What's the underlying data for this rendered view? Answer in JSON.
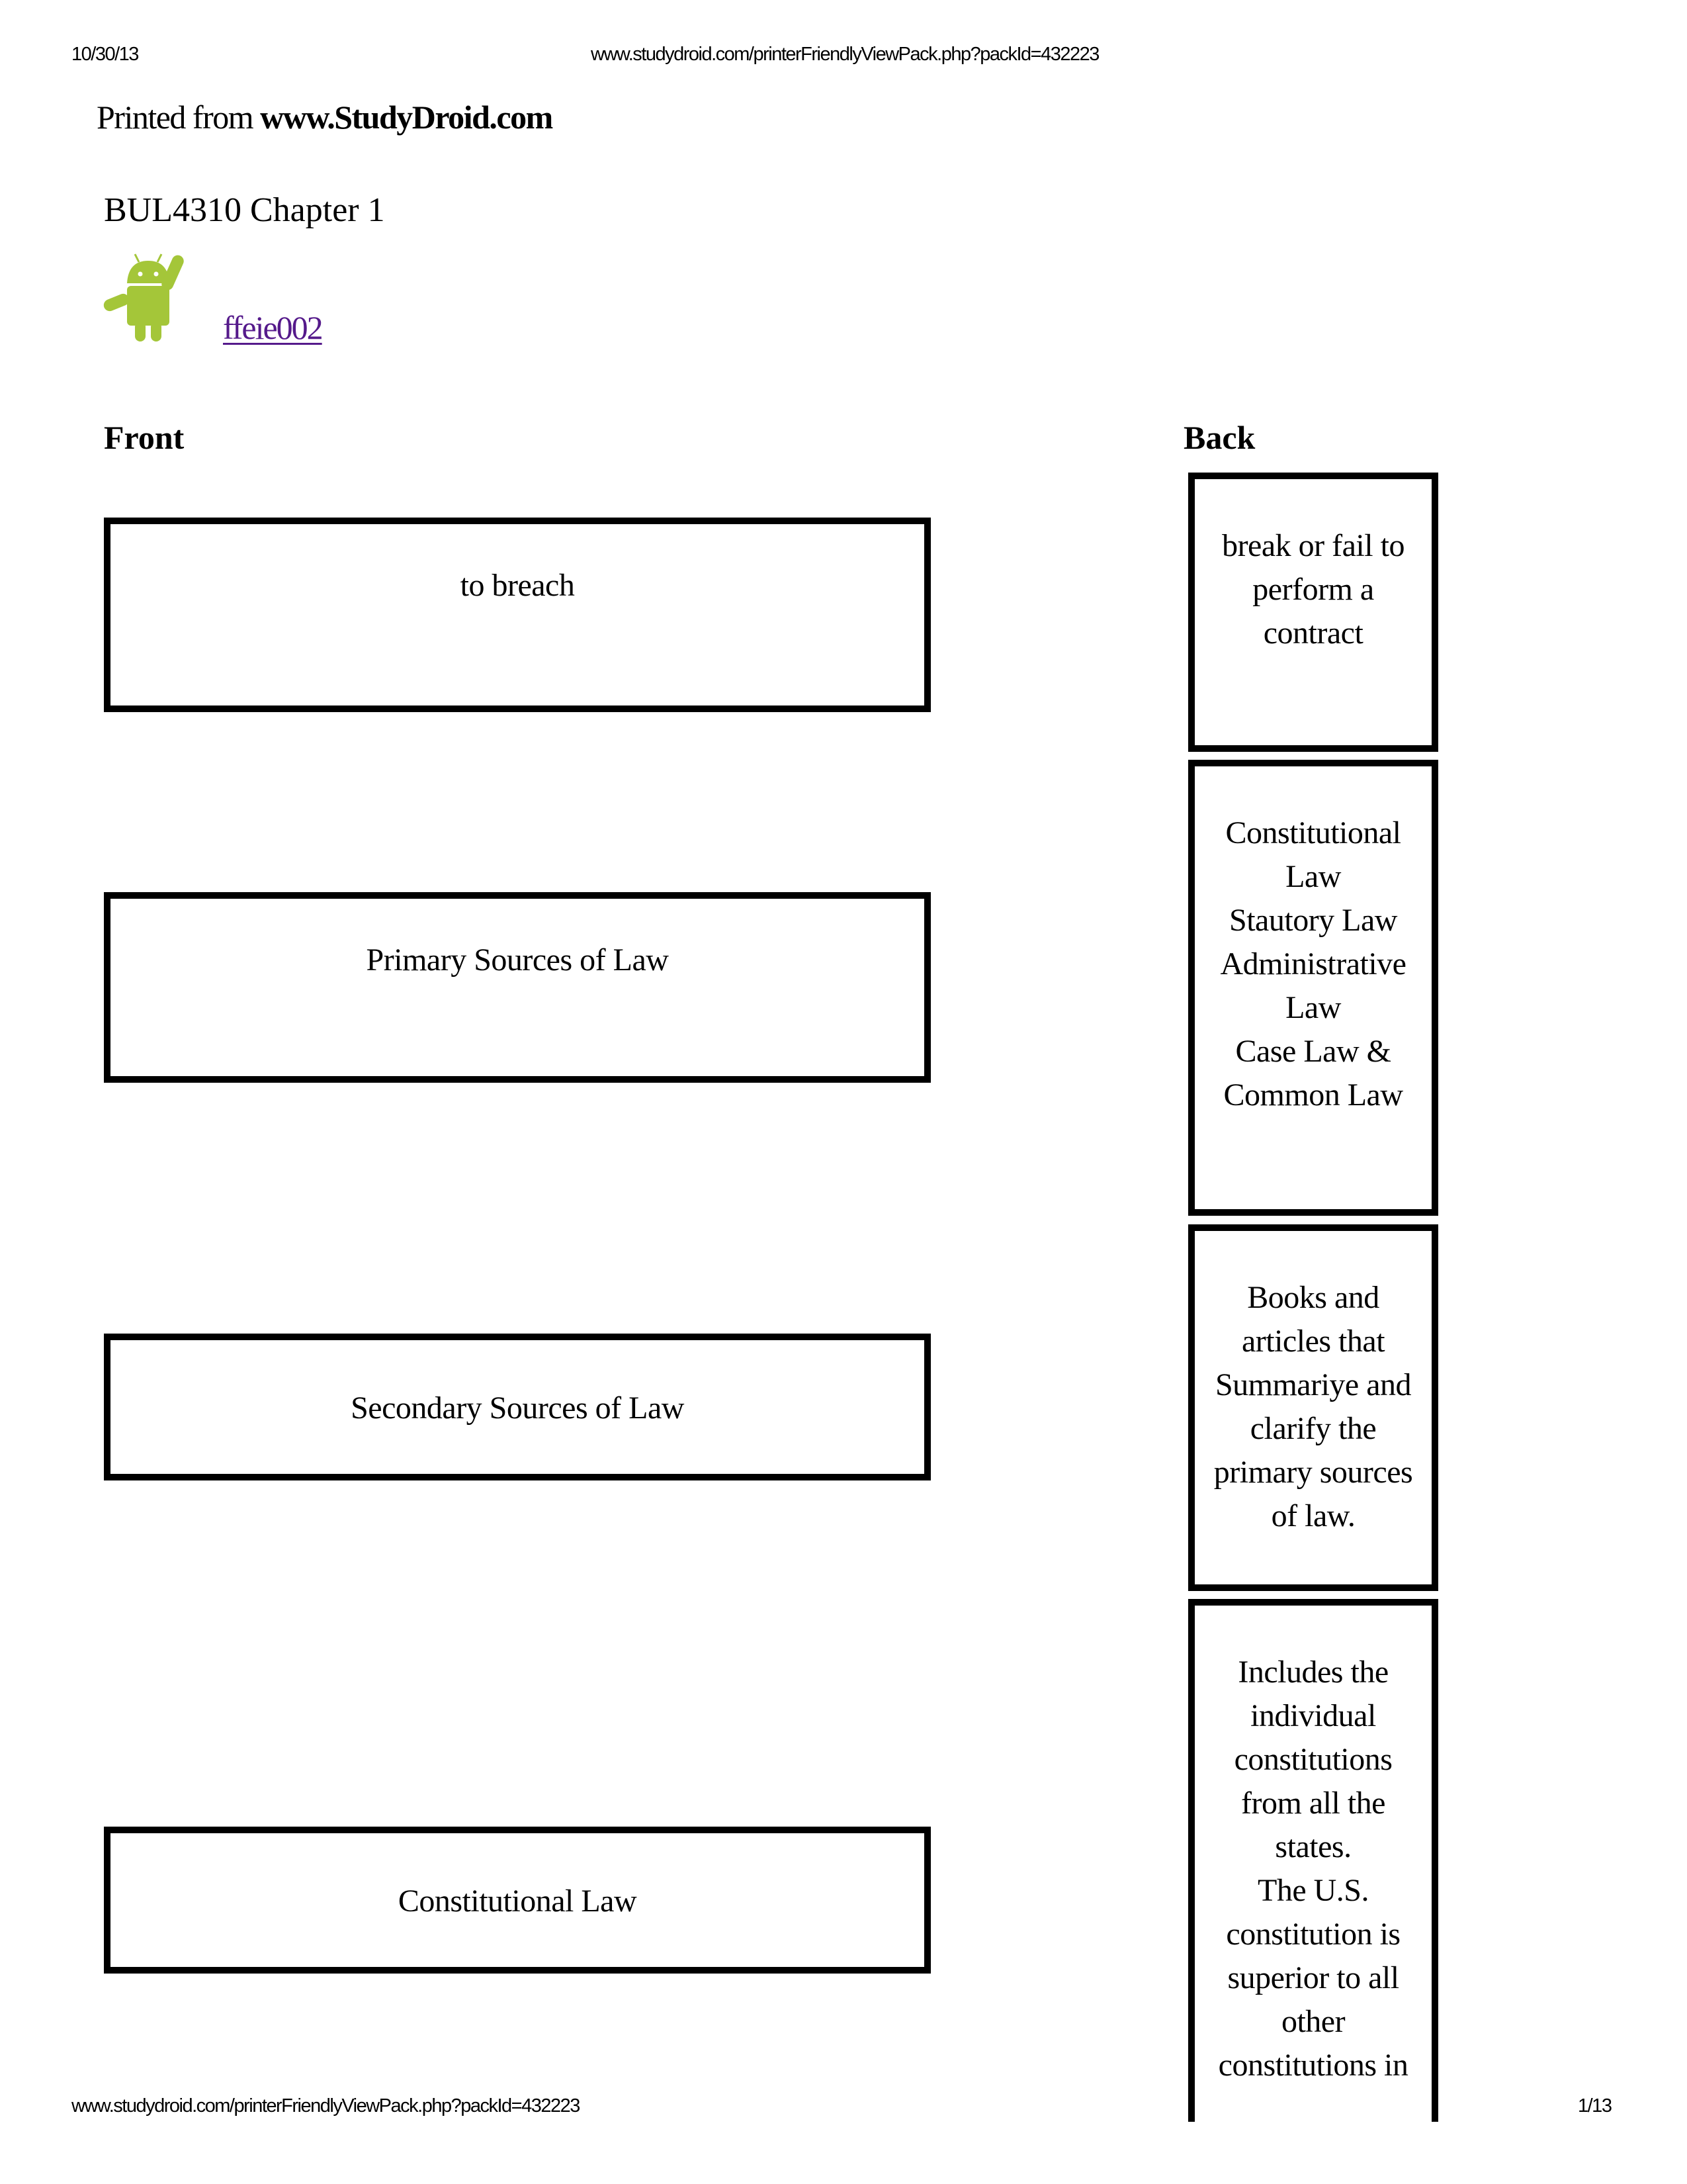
{
  "print_header": {
    "date": "10/30/13",
    "url": "www.studydroid.com/printerFriendlyViewPack.php?packId=432223"
  },
  "print_footer": {
    "url": "www.studydroid.com/printerFriendlyViewPack.php?packId=432223",
    "page": "1/13"
  },
  "banner": {
    "prefix": "Printed from ",
    "site": "www.StudyDroid.com"
  },
  "pack": {
    "title": "BUL4310 Chapter 1",
    "author": "ffeie002",
    "avatar_icon": "android-robot-icon",
    "avatar_color": "#a4c639"
  },
  "columns": {
    "front": "Front",
    "back": "Back"
  },
  "cards": [
    {
      "front": "to breach",
      "back_lines": [
        "break or fail to",
        "perform a",
        "contract"
      ]
    },
    {
      "front": "Primary Sources of Law",
      "back_lines": [
        "Constitutional",
        "Law",
        "Stautory Law",
        "Administrative",
        "Law",
        "Case Law &",
        "Common Law"
      ]
    },
    {
      "front": "Secondary Sources of Law",
      "back_lines": [
        "Books and",
        "articles that",
        "Summariye and",
        "clarify the",
        "primary sources",
        "of law."
      ]
    },
    {
      "front": "Constitutional Law",
      "back_lines": [
        "Includes the",
        "individual",
        "constitutions",
        "from all the",
        "states.",
        "The U.S.",
        "constitution is",
        "superior to all",
        "other",
        "constitutions in"
      ]
    }
  ]
}
